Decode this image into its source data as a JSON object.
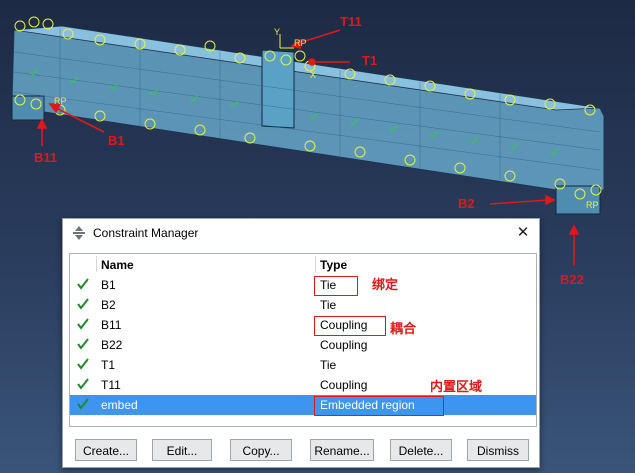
{
  "viewport": {
    "callouts": {
      "t11": "T11",
      "t1": "T1",
      "b1": "B1",
      "b11": "B11",
      "b2": "B2",
      "b22": "B22"
    },
    "axis_label_y": "Y",
    "axis_label_x": "X",
    "rp_labels": [
      "RP",
      "RP",
      "RP"
    ]
  },
  "dialog": {
    "title": "Constraint Manager",
    "close_glyph": "✕",
    "columns": {
      "name": "Name",
      "type": "Type"
    },
    "rows": [
      {
        "name": "B1",
        "type": "Tie",
        "checked": true,
        "selected": false
      },
      {
        "name": "B2",
        "type": "Tie",
        "checked": true,
        "selected": false
      },
      {
        "name": "B11",
        "type": "Coupling",
        "checked": true,
        "selected": false
      },
      {
        "name": "B22",
        "type": "Coupling",
        "checked": true,
        "selected": false
      },
      {
        "name": "T1",
        "type": "Tie",
        "checked": true,
        "selected": false
      },
      {
        "name": "T11",
        "type": "Coupling",
        "checked": true,
        "selected": false
      },
      {
        "name": "embed",
        "type": "Embedded region",
        "checked": true,
        "selected": true
      }
    ],
    "buttons": {
      "create": "Create...",
      "edit": "Edit...",
      "copy": "Copy...",
      "rename": "Rename...",
      "delete": "Delete...",
      "dismiss": "Dismiss"
    }
  },
  "annotations": {
    "tie_note": "绑定",
    "coupling_note": "耦合",
    "embedded_note": "内置区域"
  },
  "colors": {
    "accent_red": "#e01818",
    "selection_blue": "#3d95f0",
    "check_green": "#1f8a2a",
    "node_yellow": "#e8f040",
    "beam_cyan": "#7fc7e8"
  }
}
